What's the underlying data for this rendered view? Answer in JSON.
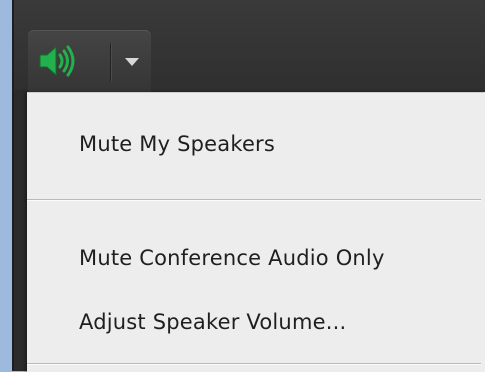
{
  "toolbar": {
    "speaker_icon": "speaker-volume-icon",
    "dropdown_icon": "chevron-down-icon",
    "accent_color": "#22b14c"
  },
  "menu": {
    "items": [
      {
        "label": "Mute My Speakers"
      },
      {
        "label": "Mute Conference Audio Only"
      },
      {
        "label": "Adjust Speaker Volume..."
      }
    ]
  }
}
